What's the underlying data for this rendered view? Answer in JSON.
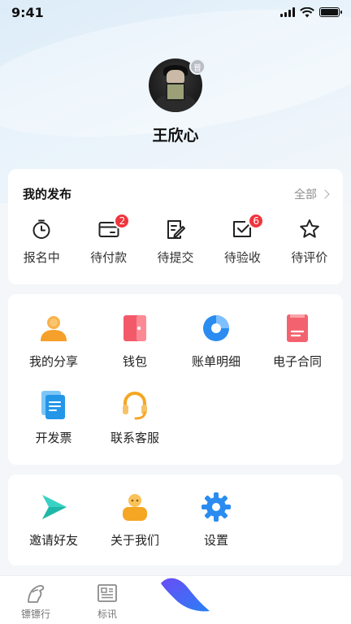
{
  "status_bar": {
    "time": "9:41"
  },
  "profile": {
    "name": "王欣心",
    "level_badge": "普"
  },
  "publish": {
    "title": "我的发布",
    "all_label": "全部",
    "items": [
      {
        "label": "报名中",
        "icon": "timer-icon"
      },
      {
        "label": "待付款",
        "icon": "card-icon",
        "count": "2"
      },
      {
        "label": "待提交",
        "icon": "edit-doc-icon"
      },
      {
        "label": "待验收",
        "icon": "check-box-icon",
        "count": "6"
      },
      {
        "label": "待评价",
        "icon": "star-icon"
      }
    ]
  },
  "tools": {
    "items": [
      {
        "label": "我的分享",
        "icon": "share-user-icon"
      },
      {
        "label": "钱包",
        "icon": "wallet-icon"
      },
      {
        "label": "账单明细",
        "icon": "bill-chart-icon"
      },
      {
        "label": "电子合同",
        "icon": "contract-icon"
      },
      {
        "label": "开发票",
        "icon": "invoice-icon"
      },
      {
        "label": "联系客服",
        "icon": "headset-icon"
      }
    ]
  },
  "more": {
    "items": [
      {
        "label": "邀请好友",
        "icon": "invite-arrow-icon"
      },
      {
        "label": "关于我们",
        "icon": "about-user-icon"
      },
      {
        "label": "设置",
        "icon": "gear-icon"
      }
    ]
  },
  "nav": {
    "items": [
      {
        "label": "镖镖行",
        "icon": "horse-icon"
      },
      {
        "label": "标讯",
        "icon": "news-icon"
      }
    ]
  },
  "colors": {
    "badge_red": "#f0353d",
    "accent_blue": "#2a8cf0",
    "accent_orange": "#f5a623"
  }
}
